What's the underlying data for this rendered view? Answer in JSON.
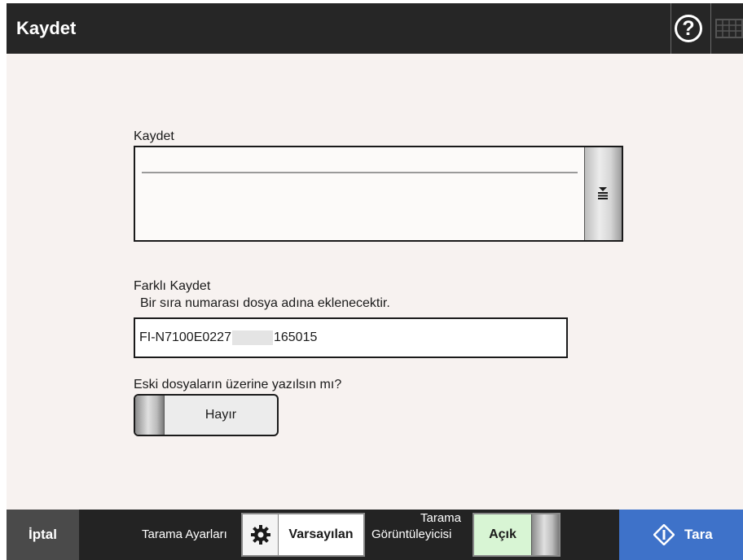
{
  "header": {
    "title": "Kaydet",
    "help_icon": "question-mark-circle-icon",
    "keyboard_icon": "keyboard-icon"
  },
  "save_section": {
    "label": "Kaydet",
    "dropdown_icon": "list-dropdown-icon"
  },
  "save_as_section": {
    "label": "Farklı Kaydet",
    "hint": "Bir sıra numarası dosya adına eklenecektir.",
    "filename_prefix": "FI-N7100E0227",
    "filename_suffix": "165015"
  },
  "overwrite_section": {
    "label": "Eski dosyaların üzerine yazılsın mı?",
    "toggle_value": "Hayır"
  },
  "footer": {
    "cancel_label": "İptal",
    "scan_settings_label": "Tarama Ayarları",
    "scan_settings_value": "Varsayılan",
    "viewer_label_line1": "Tarama",
    "viewer_label_line2": "Görüntüleyicisi",
    "viewer_value": "Açık",
    "scan_label": "Tara"
  },
  "colors": {
    "header_bg": "#262626",
    "content_bg": "#f7f2f0",
    "footer_bg": "#232323",
    "scan_button": "#3e72c9",
    "viewer_on": "#d8f5d4"
  }
}
